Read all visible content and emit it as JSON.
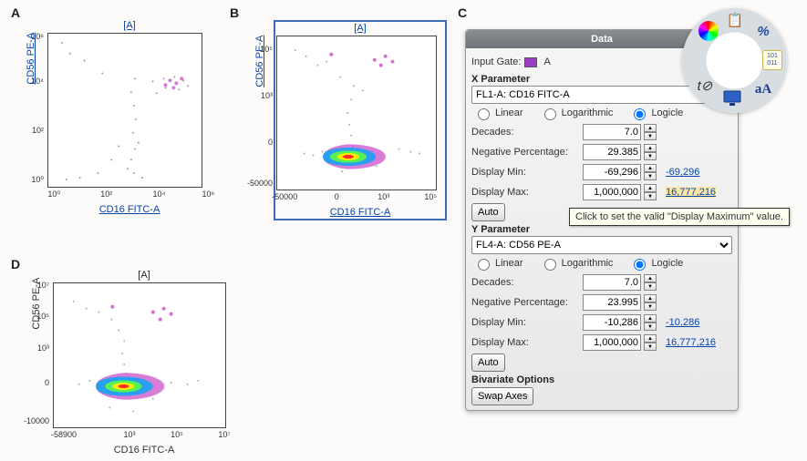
{
  "labels": {
    "A": "A",
    "B": "B",
    "C": "C",
    "D": "D"
  },
  "plots": {
    "a": {
      "title": "[A]",
      "ylabel": "CD56 PE-A",
      "xlabel": "CD16 FITC-A",
      "ticks_y": [
        "10⁰",
        "10²",
        "10⁴",
        "10⁶"
      ],
      "ticks_x": [
        "10⁰",
        "10²",
        "10⁴",
        "10⁶"
      ]
    },
    "b": {
      "title": "[A]",
      "ylabel": "CD56 PE-A",
      "xlabel": "CD16 FITC-A",
      "ticks_y": [
        "-50000",
        "0",
        "10³",
        "10⁵"
      ],
      "ticks_x": [
        "-50000",
        "0",
        "10³",
        "10⁵"
      ]
    },
    "d": {
      "title": "[A]",
      "ylabel": "CD56 PE-A",
      "xlabel": "CD16 FITC-A",
      "ticks_y": [
        "-10000",
        "0",
        "10³",
        "10⁵",
        "10⁷"
      ],
      "ticks_x": [
        "-58900",
        "10³",
        "10⁵",
        "10⁷"
      ]
    }
  },
  "panel": {
    "title": "Data",
    "input_gate_label": "Input Gate:",
    "input_gate_value": "A",
    "x_section": "X Parameter",
    "x_param": "FL1-A: CD16 FITC-A",
    "y_section": "Y Parameter",
    "y_param": "FL4-A: CD56 PE-A",
    "scale_linear": "Linear",
    "scale_log": "Logarithmic",
    "scale_logicle": "Logicle",
    "decades_label": "Decades:",
    "negpct_label": "Negative Percentage:",
    "dispmin_label": "Display Min:",
    "dispmax_label": "Display Max:",
    "auto": "Auto",
    "x": {
      "decades": "7.0",
      "negpct": "29.385",
      "dispmin": "-69,296",
      "dispmin_link": "-69,296",
      "dispmax": "1,000,000",
      "dispmax_link": "16,777,216"
    },
    "y": {
      "decades": "7.0",
      "negpct": "23.995",
      "dispmin": "-10,286",
      "dispmin_link": "-10,286",
      "dispmax": "1,000,000",
      "dispmax_link": "16,777,216"
    },
    "bivariate": "Bivariate Options",
    "swap": "Swap Axes"
  },
  "tooltip": "Click to set the valid \"Display Maximum\" value.",
  "donut": {
    "colorwheel": "color-wheel-icon",
    "clipboard": "clipboard-icon",
    "percent": "percent-icon",
    "binary": "binary-icon",
    "font": "font-icon",
    "axes": "axes-icon",
    "monitor": "monitor-icon"
  }
}
